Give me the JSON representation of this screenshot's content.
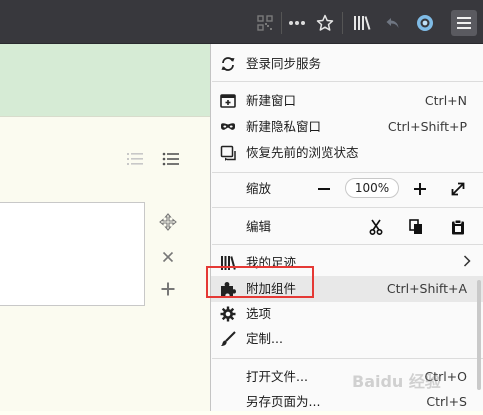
{
  "menu": {
    "sync": "登录同步服务",
    "new_window": "新建窗口",
    "new_window_sc": "Ctrl+N",
    "private_window": "新建隐私窗口",
    "private_window_sc": "Ctrl+Shift+P",
    "restore_session": "恢复先前的浏览状态",
    "zoom_label": "缩放",
    "zoom_value": "100%",
    "edit_label": "编辑",
    "library": "我的足迹",
    "addons": "附加组件",
    "addons_sc": "Ctrl+Shift+A",
    "options": "选项",
    "customize": "定制...",
    "open_file": "打开文件...",
    "open_file_sc": "Ctrl+O",
    "save_page": "另存页面为...",
    "save_page_sc": "Ctrl+S"
  },
  "watermark": "Baidu 经验",
  "colors": {
    "toolbar_bg": "#38383d",
    "menu_bg": "#fafafa",
    "highlight_bg": "#e8e8e8",
    "annotation_red": "#e53935",
    "green_band": "#d6ebd5",
    "page_bg": "#fbfbf0"
  },
  "icons": [
    "qr-code-icon",
    "more-actions-icon",
    "bookmark-star-icon",
    "library-icon",
    "undo-icon",
    "profile-icon",
    "hamburger-menu-icon",
    "sync-icon",
    "new-window-icon",
    "mask-icon",
    "restore-session-icon",
    "zoom-out-icon",
    "zoom-in-icon",
    "fullscreen-icon",
    "cut-icon",
    "copy-icon",
    "paste-icon",
    "library-icon",
    "chevron-right-icon",
    "puzzle-icon",
    "gear-icon",
    "brush-icon",
    "move-icon",
    "close-icon",
    "add-icon",
    "list-icon",
    "ordered-list-icon"
  ]
}
